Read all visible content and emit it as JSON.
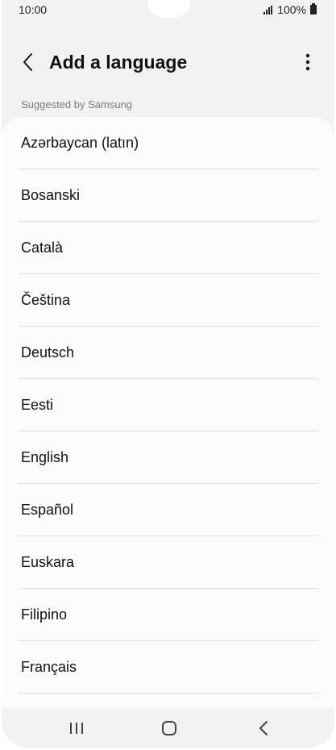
{
  "status_bar": {
    "time": "10:00",
    "battery": "100%",
    "icons": [
      "signal-icon",
      "battery-icon"
    ]
  },
  "header": {
    "title": "Add a language",
    "back_icon": "chevron-left-icon",
    "more_icon": "more-vertical-icon"
  },
  "section": {
    "label": "Suggested by Samsung"
  },
  "languages": [
    "Azərbaycan (latın)",
    "Bosanski",
    "Català",
    "Čeština",
    "Deutsch",
    "Eesti",
    "English",
    "Español",
    "Euskara",
    "Filipino",
    "Français"
  ],
  "nav_bar": {
    "icons": [
      "recent-apps-icon",
      "home-icon",
      "back-icon"
    ]
  },
  "colors": {
    "background": "#f2f2f2",
    "card": "#fcfcfc",
    "text": "#111111",
    "secondary_text": "#7a7a7a"
  }
}
